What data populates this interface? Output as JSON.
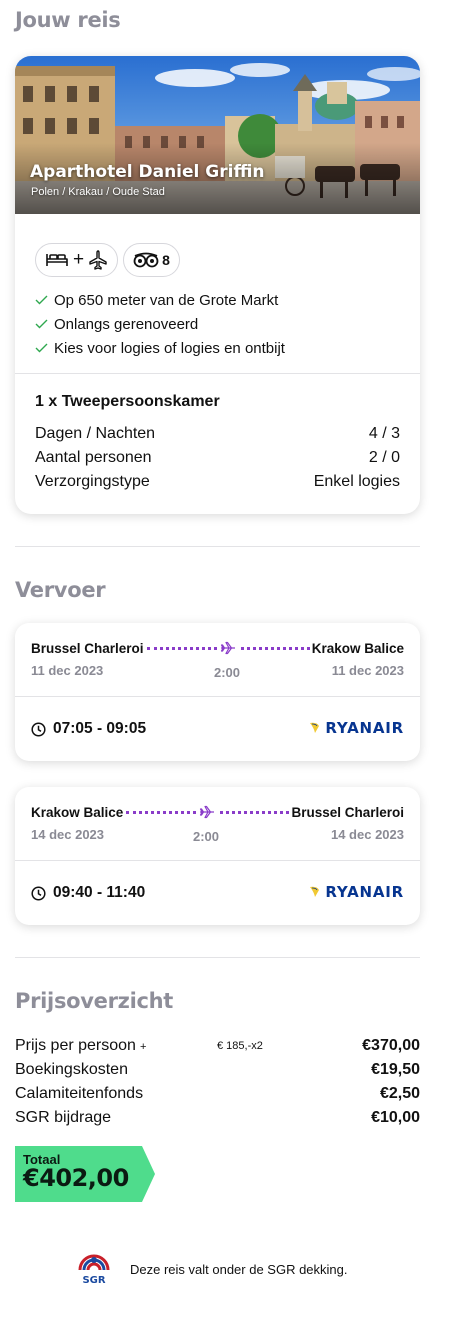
{
  "trip": {
    "title": "Jouw reis"
  },
  "hotel": {
    "name": "Aparthotel Daniel Griffin",
    "location": "Polen / Krakau / Oude Stad",
    "badges": {
      "transport_icons": [
        "bed-icon",
        "plane-icon"
      ],
      "rating_icon": "tripadvisor-icon",
      "rating": "8"
    },
    "features": [
      "Op 650 meter van de Grote Markt",
      "Onlangs gerenoveerd",
      "Kies voor logies of logies en ontbijt"
    ],
    "room": {
      "title": "1 x Tweepersoonskamer",
      "rows": [
        {
          "label": "Dagen / Nachten",
          "value": "4 / 3"
        },
        {
          "label": "Aantal personen",
          "value": "2 / 0"
        },
        {
          "label": "Verzorgingstype",
          "value": "Enkel logies"
        }
      ]
    }
  },
  "transport": {
    "title": "Vervoer",
    "flights": [
      {
        "from": "Brussel Charleroi",
        "to": "Krakow Balice",
        "date_from": "11 dec 2023",
        "date_to": "11 dec 2023",
        "duration": "2:00",
        "time": "07:05 - 09:05",
        "airline": "RYANAIR"
      },
      {
        "from": "Krakow Balice",
        "to": "Brussel Charleroi",
        "date_from": "14 dec 2023",
        "date_to": "14 dec 2023",
        "duration": "2:00",
        "time": "09:40 - 11:40",
        "airline": "RYANAIR"
      }
    ]
  },
  "prices": {
    "title": "Prijsoverzicht",
    "rows": [
      {
        "label": "Prijs per persoon",
        "extra": "+",
        "detail": "€ 185,-x2",
        "value": "€370,00"
      },
      {
        "label": "Boekingskosten",
        "extra": "",
        "detail": "",
        "value": "€19,50"
      },
      {
        "label": "Calamiteitenfonds",
        "extra": "",
        "detail": "",
        "value": "€2,50"
      },
      {
        "label": "SGR bijdrage",
        "extra": "",
        "detail": "",
        "value": "€10,00"
      }
    ],
    "total_label": "Totaal",
    "total_value": "€402,00"
  },
  "sgr": {
    "logo_text": "SGR",
    "text": "Deze reis valt onder de SGR dekking."
  },
  "colors": {
    "accent_purple": "#8a3cc9",
    "total_green": "#4fdc8c",
    "ryanair_blue": "#073590",
    "section_gray": "#8e8e99"
  }
}
